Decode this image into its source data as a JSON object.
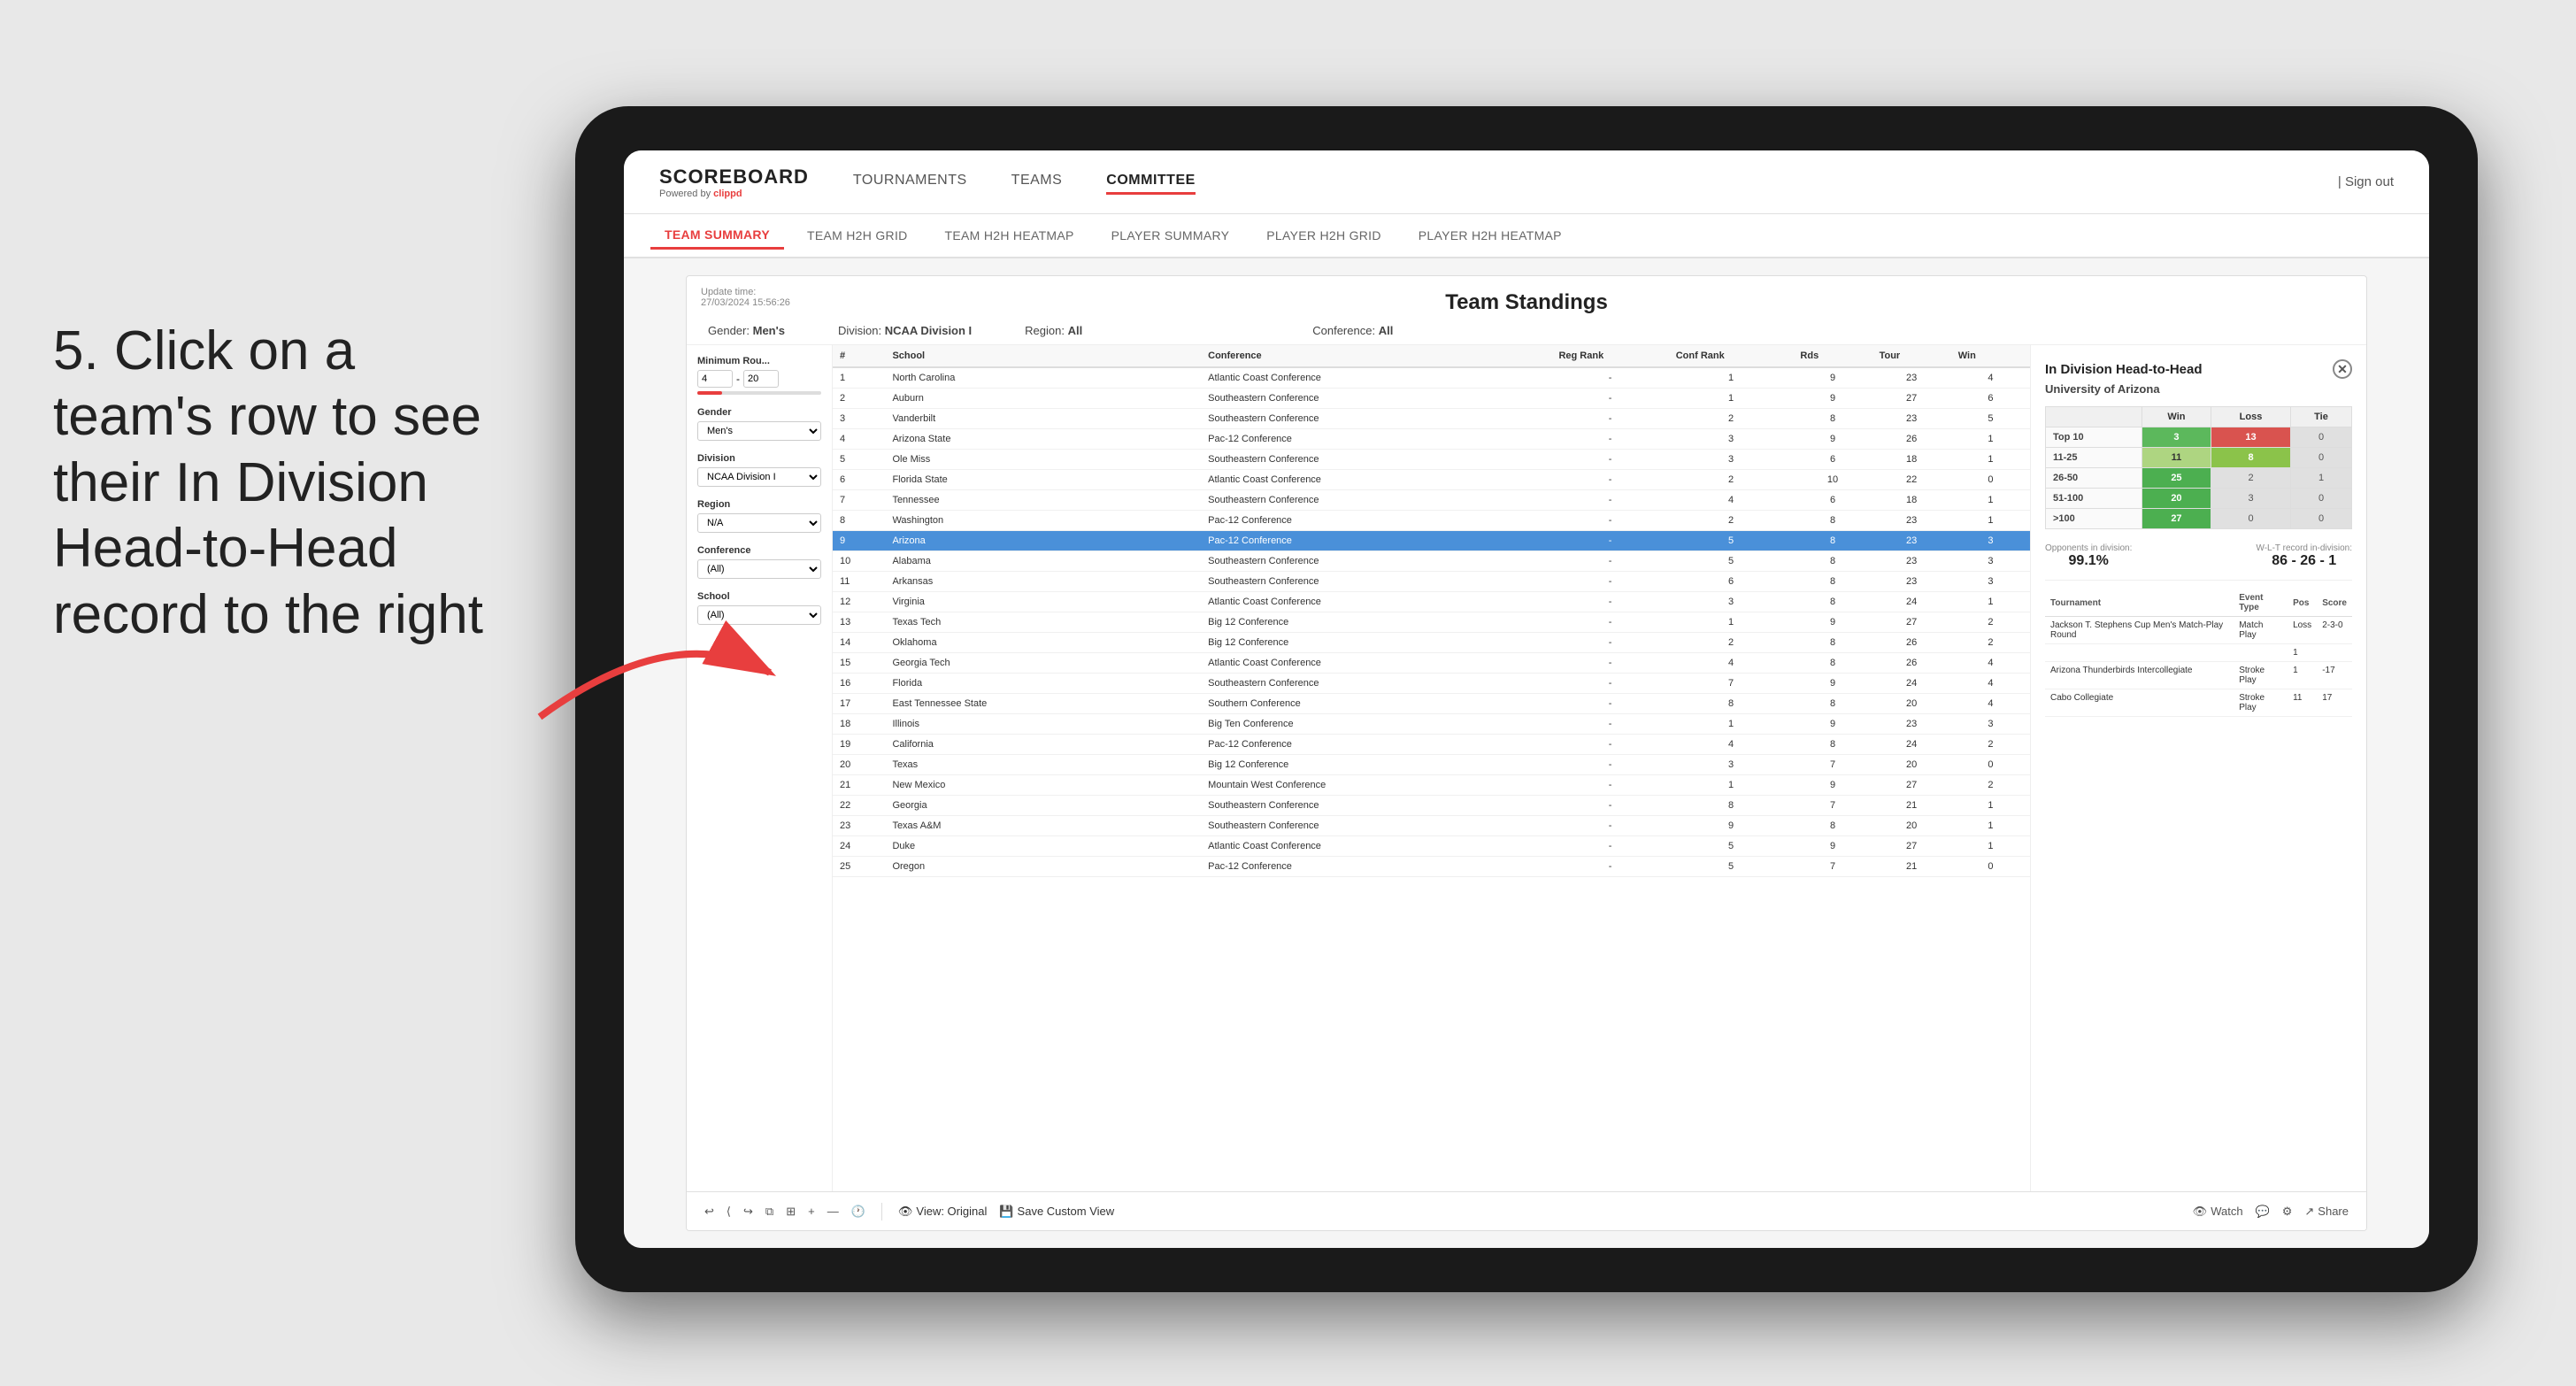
{
  "annotation": {
    "text": "5. Click on a team's row to see their In Division Head-to-Head record to the right"
  },
  "nav": {
    "logo": "SCOREBOARD",
    "logo_sub": "Powered by",
    "logo_brand": "clippd",
    "items": [
      "TOURNAMENTS",
      "TEAMS",
      "COMMITTEE"
    ],
    "active_item": "COMMITTEE",
    "sign_out": "Sign out"
  },
  "sub_nav": {
    "items": [
      "TEAM SUMMARY",
      "TEAM H2H GRID",
      "TEAM H2H HEATMAP",
      "PLAYER SUMMARY",
      "PLAYER H2H GRID",
      "PLAYER H2H HEATMAP"
    ],
    "active_item": "PLAYER SUMMARY"
  },
  "panel": {
    "update_label": "Update time:",
    "update_time": "27/03/2024 15:56:26",
    "title": "Team Standings",
    "filters": {
      "gender_label": "Gender:",
      "gender_value": "Men's",
      "division_label": "Division:",
      "division_value": "NCAA Division I",
      "region_label": "Region:",
      "region_value": "All",
      "conference_label": "Conference:",
      "conference_value": "All"
    }
  },
  "left_filters": {
    "min_rounds_label": "Minimum Rou...",
    "min_val": "4",
    "max_val": "20",
    "gender_label": "Gender",
    "gender_val": "Men's",
    "division_label": "Division",
    "division_val": "NCAA Division I",
    "region_label": "Region",
    "region_val": "N/A",
    "conference_label": "Conference",
    "conference_val": "(All)",
    "school_label": "School",
    "school_val": "(All)"
  },
  "table": {
    "headers": [
      "#",
      "School",
      "Conference",
      "Reg Rank",
      "Conf Rank",
      "Rds",
      "Tour",
      "Win"
    ],
    "rows": [
      {
        "rank": "1",
        "school": "North Carolina",
        "conference": "Atlantic Coast Conference",
        "reg_rank": "-",
        "conf_rank": "1",
        "rds": "9",
        "tour": "23",
        "win": "4"
      },
      {
        "rank": "2",
        "school": "Auburn",
        "conference": "Southeastern Conference",
        "reg_rank": "-",
        "conf_rank": "1",
        "rds": "9",
        "tour": "27",
        "win": "6"
      },
      {
        "rank": "3",
        "school": "Vanderbilt",
        "conference": "Southeastern Conference",
        "reg_rank": "-",
        "conf_rank": "2",
        "rds": "8",
        "tour": "23",
        "win": "5"
      },
      {
        "rank": "4",
        "school": "Arizona State",
        "conference": "Pac-12 Conference",
        "reg_rank": "-",
        "conf_rank": "3",
        "rds": "9",
        "tour": "26",
        "win": "1"
      },
      {
        "rank": "5",
        "school": "Ole Miss",
        "conference": "Southeastern Conference",
        "reg_rank": "-",
        "conf_rank": "3",
        "rds": "6",
        "tour": "18",
        "win": "1"
      },
      {
        "rank": "6",
        "school": "Florida State",
        "conference": "Atlantic Coast Conference",
        "reg_rank": "-",
        "conf_rank": "2",
        "rds": "10",
        "tour": "22",
        "win": "0"
      },
      {
        "rank": "7",
        "school": "Tennessee",
        "conference": "Southeastern Conference",
        "reg_rank": "-",
        "conf_rank": "4",
        "rds": "6",
        "tour": "18",
        "win": "1"
      },
      {
        "rank": "8",
        "school": "Washington",
        "conference": "Pac-12 Conference",
        "reg_rank": "-",
        "conf_rank": "2",
        "rds": "8",
        "tour": "23",
        "win": "1"
      },
      {
        "rank": "9",
        "school": "Arizona",
        "conference": "Pac-12 Conference",
        "reg_rank": "-",
        "conf_rank": "5",
        "rds": "8",
        "tour": "23",
        "win": "3",
        "highlighted": true
      },
      {
        "rank": "10",
        "school": "Alabama",
        "conference": "Southeastern Conference",
        "reg_rank": "-",
        "conf_rank": "5",
        "rds": "8",
        "tour": "23",
        "win": "3"
      },
      {
        "rank": "11",
        "school": "Arkansas",
        "conference": "Southeastern Conference",
        "reg_rank": "-",
        "conf_rank": "6",
        "rds": "8",
        "tour": "23",
        "win": "3"
      },
      {
        "rank": "12",
        "school": "Virginia",
        "conference": "Atlantic Coast Conference",
        "reg_rank": "-",
        "conf_rank": "3",
        "rds": "8",
        "tour": "24",
        "win": "1"
      },
      {
        "rank": "13",
        "school": "Texas Tech",
        "conference": "Big 12 Conference",
        "reg_rank": "-",
        "conf_rank": "1",
        "rds": "9",
        "tour": "27",
        "win": "2"
      },
      {
        "rank": "14",
        "school": "Oklahoma",
        "conference": "Big 12 Conference",
        "reg_rank": "-",
        "conf_rank": "2",
        "rds": "8",
        "tour": "26",
        "win": "2"
      },
      {
        "rank": "15",
        "school": "Georgia Tech",
        "conference": "Atlantic Coast Conference",
        "reg_rank": "-",
        "conf_rank": "4",
        "rds": "8",
        "tour": "26",
        "win": "4"
      },
      {
        "rank": "16",
        "school": "Florida",
        "conference": "Southeastern Conference",
        "reg_rank": "-",
        "conf_rank": "7",
        "rds": "9",
        "tour": "24",
        "win": "4"
      },
      {
        "rank": "17",
        "school": "East Tennessee State",
        "conference": "Southern Conference",
        "reg_rank": "-",
        "conf_rank": "8",
        "rds": "8",
        "tour": "20",
        "win": "4"
      },
      {
        "rank": "18",
        "school": "Illinois",
        "conference": "Big Ten Conference",
        "reg_rank": "-",
        "conf_rank": "1",
        "rds": "9",
        "tour": "23",
        "win": "3"
      },
      {
        "rank": "19",
        "school": "California",
        "conference": "Pac-12 Conference",
        "reg_rank": "-",
        "conf_rank": "4",
        "rds": "8",
        "tour": "24",
        "win": "2"
      },
      {
        "rank": "20",
        "school": "Texas",
        "conference": "Big 12 Conference",
        "reg_rank": "-",
        "conf_rank": "3",
        "rds": "7",
        "tour": "20",
        "win": "0"
      },
      {
        "rank": "21",
        "school": "New Mexico",
        "conference": "Mountain West Conference",
        "reg_rank": "-",
        "conf_rank": "1",
        "rds": "9",
        "tour": "27",
        "win": "2"
      },
      {
        "rank": "22",
        "school": "Georgia",
        "conference": "Southeastern Conference",
        "reg_rank": "-",
        "conf_rank": "8",
        "rds": "7",
        "tour": "21",
        "win": "1"
      },
      {
        "rank": "23",
        "school": "Texas A&M",
        "conference": "Southeastern Conference",
        "reg_rank": "-",
        "conf_rank": "9",
        "rds": "8",
        "tour": "20",
        "win": "1"
      },
      {
        "rank": "24",
        "school": "Duke",
        "conference": "Atlantic Coast Conference",
        "reg_rank": "-",
        "conf_rank": "5",
        "rds": "9",
        "tour": "27",
        "win": "1"
      },
      {
        "rank": "25",
        "school": "Oregon",
        "conference": "Pac-12 Conference",
        "reg_rank": "-",
        "conf_rank": "5",
        "rds": "7",
        "tour": "21",
        "win": "0"
      }
    ]
  },
  "h2h": {
    "title": "In Division Head-to-Head",
    "team": "University of Arizona",
    "record_headers": [
      "",
      "Win",
      "Loss",
      "Tie"
    ],
    "record_rows": [
      {
        "label": "Top 10",
        "win": "3",
        "loss": "13",
        "tie": "0",
        "win_class": "cell-green",
        "loss_class": "cell-red",
        "tie_class": "cell-gray"
      },
      {
        "label": "11-25",
        "win": "11",
        "loss": "8",
        "tie": "0",
        "win_class": "cell-yellow-green",
        "loss_class": "cell-light-green",
        "tie_class": "cell-gray"
      },
      {
        "label": "26-50",
        "win": "25",
        "loss": "2",
        "tie": "1",
        "win_class": "cell-dark-green",
        "loss_class": "cell-gray",
        "tie_class": "cell-gray"
      },
      {
        "label": "51-100",
        "win": "20",
        "loss": "3",
        "tie": "0",
        "win_class": "cell-dark-green",
        "loss_class": "cell-gray",
        "tie_class": "cell-gray"
      },
      {
        "label": ">100",
        "win": "27",
        "loss": "0",
        "tie": "0",
        "win_class": "cell-dark-green",
        "loss_class": "cell-gray",
        "tie_class": "cell-gray"
      }
    ],
    "opponents_label": "Opponents in division:",
    "opponents_value": "99.1%",
    "record_label": "W-L-T record in-division:",
    "record_value": "86 - 26 - 1",
    "tournament_headers": [
      "Tournament",
      "Event Type",
      "Pos",
      "Score"
    ],
    "tournament_rows": [
      {
        "tournament": "Jackson T. Stephens Cup Men's Match-Play Round",
        "event_type": "Match Play",
        "pos": "Loss",
        "score": "2-3-0"
      },
      {
        "tournament": "",
        "event_type": "",
        "pos": "1",
        "score": ""
      },
      {
        "tournament": "Arizona Thunderbirds Intercollegiate",
        "event_type": "Stroke Play",
        "pos": "1",
        "score": "-17"
      },
      {
        "tournament": "Cabo Collegiate",
        "event_type": "Stroke Play",
        "pos": "11",
        "score": "17"
      }
    ]
  },
  "toolbar": {
    "undo": "↩",
    "redo": "↪",
    "view_original": "View: Original",
    "save_custom": "Save Custom View",
    "watch": "Watch",
    "share": "Share"
  }
}
